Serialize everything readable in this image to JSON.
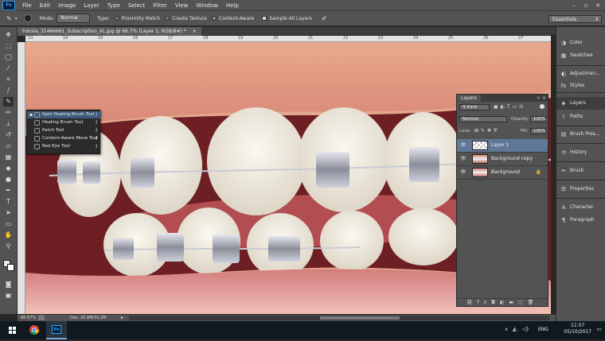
{
  "app": {
    "logo": "Ps"
  },
  "menu": [
    "File",
    "Edit",
    "Image",
    "Layer",
    "Type",
    "Select",
    "Filter",
    "View",
    "Window",
    "Help"
  ],
  "options_bar": {
    "mode_label": "Mode:",
    "mode_value": "Normal",
    "type_label": "Type:",
    "type_options": [
      {
        "label": "Proximity Match",
        "selected": false
      },
      {
        "label": "Create Texture",
        "selected": false
      },
      {
        "label": "Content-Aware",
        "selected": true
      }
    ],
    "sample_all_layers": "Sample All Layers",
    "workspace": "Essentials"
  },
  "document": {
    "tab_title": "Fotolia_31466661_Subscription_XL.jpg @ 66.7% (Layer 1, RGB/8#) *",
    "ruler_ticks": [
      "13",
      "14",
      "15",
      "16",
      "17",
      "18",
      "19",
      "20",
      "21",
      "22",
      "23",
      "24",
      "25",
      "26",
      "27"
    ],
    "zoom": "66.67%",
    "doc_size": "Doc: 20.8M/33.2M"
  },
  "tool_flyout": [
    {
      "label": "Spot Healing Brush Tool",
      "key": "J",
      "selected": true
    },
    {
      "label": "Healing Brush Tool",
      "key": "J",
      "selected": false
    },
    {
      "label": "Patch Tool",
      "key": "J",
      "selected": false
    },
    {
      "label": "Content-Aware Move Tool",
      "key": "J",
      "selected": false
    },
    {
      "label": "Red Eye Tool",
      "key": "J",
      "selected": false
    }
  ],
  "layers_panel": {
    "title": "Layers",
    "filter": "Kind",
    "blend_mode": "Normal",
    "opacity_label": "Opacity:",
    "opacity": "100%",
    "lock_label": "Lock:",
    "fill_label": "Fill:",
    "fill": "100%",
    "layers": [
      {
        "name": "Layer 1",
        "selected": true,
        "italic": false
      },
      {
        "name": "Background copy",
        "selected": false,
        "italic": false
      },
      {
        "name": "Background",
        "selected": false,
        "italic": true
      }
    ]
  },
  "dock": [
    {
      "label": "Color",
      "icon": "color-icon"
    },
    {
      "label": "Swatches",
      "icon": "swatches-icon"
    },
    {
      "label": "Adjustmen...",
      "icon": "adjustments-icon"
    },
    {
      "label": "Styles",
      "icon": "styles-icon"
    },
    {
      "label": "Layers",
      "icon": "layers-icon"
    },
    {
      "label": "Paths",
      "icon": "paths-icon"
    },
    {
      "label": "Brush Pres...",
      "icon": "brush-presets-icon"
    },
    {
      "label": "History",
      "icon": "history-icon"
    },
    {
      "label": "Brush",
      "icon": "brush-icon"
    },
    {
      "label": "Properties",
      "icon": "properties-icon"
    },
    {
      "label": "Character",
      "icon": "character-icon"
    },
    {
      "label": "Paragraph",
      "icon": "paragraph-icon"
    }
  ],
  "taskbar": {
    "language": "ENG",
    "time": "11:07",
    "date": "05/10/2017"
  },
  "colors": {
    "ui_panel": "#535353",
    "selection": "#5f7898",
    "ps_blue": "#2fa3f5"
  }
}
